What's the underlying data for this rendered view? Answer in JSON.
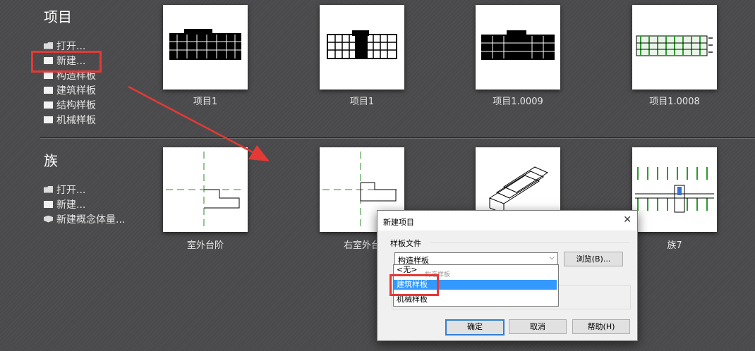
{
  "projects": {
    "title": "项目",
    "links": [
      {
        "label": "打开...",
        "icon": "folder-icon"
      },
      {
        "label": "新建...",
        "icon": "new-document-icon"
      },
      {
        "label": "构造样板",
        "icon": "template-icon"
      },
      {
        "label": "建筑样板",
        "icon": "template-icon"
      },
      {
        "label": "结构样板",
        "icon": "template-icon"
      },
      {
        "label": "机械样板",
        "icon": "template-icon"
      }
    ],
    "thumbnails": [
      {
        "label": "项目1"
      },
      {
        "label": "项目1"
      },
      {
        "label": "项目1.0009"
      },
      {
        "label": "项目1.0008"
      }
    ]
  },
  "families": {
    "title": "族",
    "links": [
      {
        "label": "打开...",
        "icon": "folder-icon"
      },
      {
        "label": "新建...",
        "icon": "new-document-icon"
      },
      {
        "label": "新建概念体量...",
        "icon": "mass-cube-icon"
      }
    ],
    "thumbnails": [
      {
        "label": "室外台阶"
      },
      {
        "label": "右室外台"
      },
      {
        "label": ""
      },
      {
        "label": "族7"
      }
    ]
  },
  "dialog": {
    "title": "新建项目",
    "template_group_label": "样板文件",
    "selected_template": "构造样板",
    "browse_label": "浏览(B)...",
    "options": [
      "<无>",
      "构造样板",
      "建筑样板",
      "机械样板"
    ],
    "highlighted_option": "建筑样板",
    "ok_label": "确定",
    "cancel_label": "取消",
    "help_label": "帮助(H)"
  },
  "colors": {
    "annotation_red": "#e53935",
    "selection_blue": "#3399ff"
  }
}
